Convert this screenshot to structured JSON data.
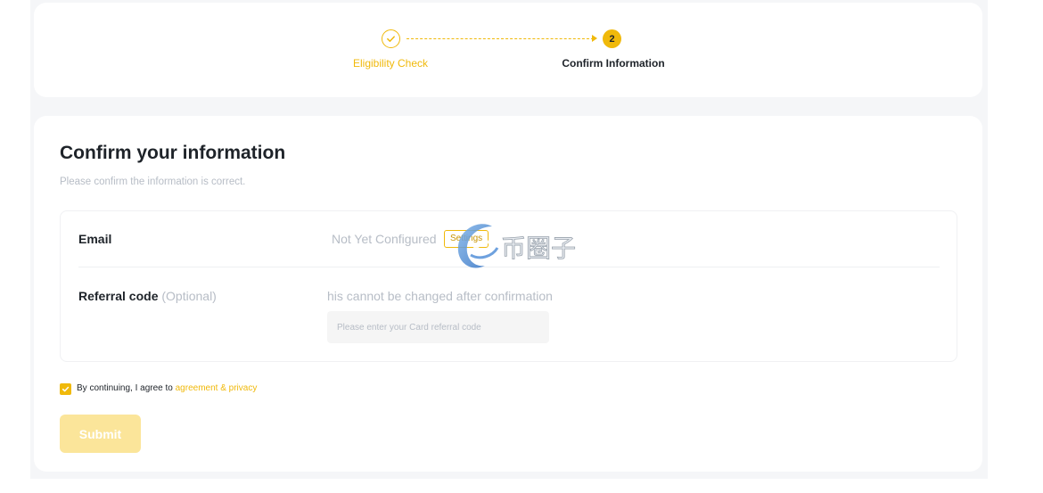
{
  "stepper": {
    "step1_label": "Eligibility Check",
    "step2_number": "2",
    "step2_label": "Confirm Information"
  },
  "main": {
    "title": "Confirm your information",
    "subtitle": "Please confirm the information is correct.",
    "email": {
      "label": "Email",
      "value": "Not Yet Configured",
      "settings_label": "Settings"
    },
    "referral": {
      "label": "Referral code",
      "optional": "(Optional)",
      "note": "his cannot be changed after confirmation",
      "placeholder": "Please enter your Card referral code"
    },
    "agreement": {
      "text": "By continuing, I agree to ",
      "link": "agreement & privacy",
      "checked": true
    },
    "submit_label": "Submit"
  },
  "watermark": {
    "text": "币圈子"
  },
  "colors": {
    "accent": "#f0b90b",
    "text": "#1e2329",
    "muted": "#b7bdc6",
    "button_disabled": "#fbe59a"
  }
}
